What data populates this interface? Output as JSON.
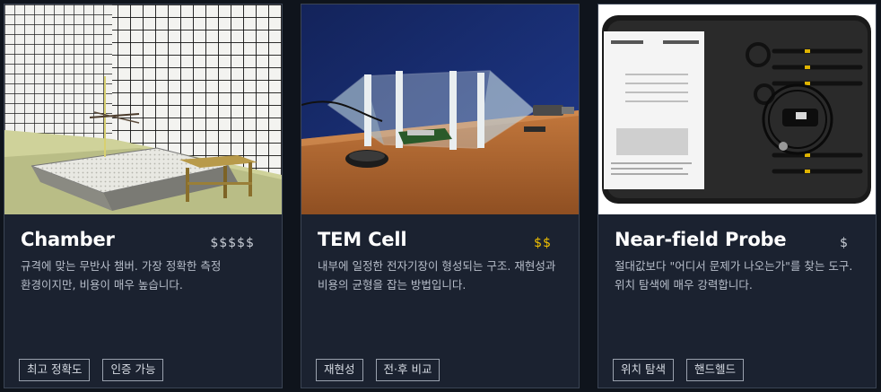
{
  "cards": [
    {
      "title": "Chamber",
      "price": "$$$$$",
      "price_color": "#c9ced6",
      "description": "규격에 맞는 무반사 챔버. 가장 정확한 측정 환경이지만, 비용이 매우 높습니다.",
      "tags": [
        "최고 정확도",
        "인증 가능"
      ],
      "image_icon": "anechoic-chamber-photo"
    },
    {
      "title": "TEM Cell",
      "price": "$$",
      "price_color": "#f2c200",
      "description": "내부에 일정한 전자기장이 형성되는 구조. 재현성과 비용의 균형을 잡는 방법입니다.",
      "tags": [
        "재현성",
        "전·후 비교"
      ],
      "image_icon": "tem-cell-photo"
    },
    {
      "title": "Near-field Probe",
      "price": "$",
      "price_color": "#c9ced6",
      "description": "절대값보다 \"어디서 문제가 나오는가\"를 찾는 도구. 위치 탐색에 매우 강력합니다.",
      "tags": [
        "위치 탐색",
        "핸드헬드"
      ],
      "image_icon": "near-field-probe-kit-photo"
    }
  ]
}
